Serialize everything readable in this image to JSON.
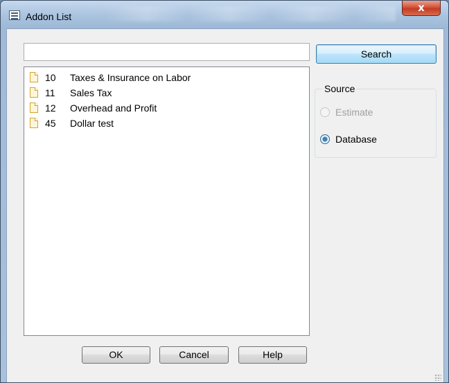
{
  "window": {
    "title": "Addon List",
    "close_glyph": "x"
  },
  "search": {
    "value": "",
    "placeholder": "",
    "button_label": "Search"
  },
  "list": {
    "items": [
      {
        "code": "10",
        "name": "Taxes & Insurance on Labor",
        "icon": "document-icon"
      },
      {
        "code": "11",
        "name": "Sales Tax",
        "icon": "document-icon"
      },
      {
        "code": "12",
        "name": "Overhead and Profit",
        "icon": "document-icon"
      },
      {
        "code": "45",
        "name": "Dollar test",
        "icon": "document-icon"
      }
    ]
  },
  "source": {
    "label": "Source",
    "options": [
      {
        "label": "Estimate",
        "checked": false,
        "enabled": false
      },
      {
        "label": "Database",
        "checked": true,
        "enabled": true
      }
    ]
  },
  "buttons": {
    "ok": "OK",
    "cancel": "Cancel",
    "help": "Help"
  },
  "colors": {
    "close_button": "#c33b22",
    "accent": "#3c7fb1"
  }
}
